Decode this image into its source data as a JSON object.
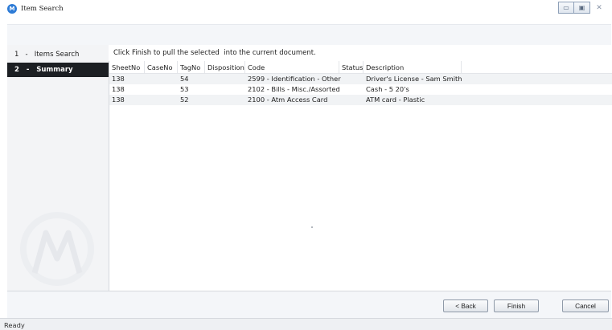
{
  "window": {
    "title": "Item Search",
    "app_icon": "motorola-icon",
    "controls": [
      "minimize-icon",
      "maximize-icon",
      "close-icon"
    ]
  },
  "sidebar": {
    "steps": [
      {
        "number": "1",
        "separator": "-",
        "label": "Items Search",
        "active": false
      },
      {
        "number": "2",
        "separator": "-",
        "label": "Summary",
        "active": true
      }
    ],
    "logo": "motorola-logo"
  },
  "main": {
    "instruction": "Click Finish to pull the selected  into the current document.",
    "table": {
      "columns": [
        "SheetNo",
        "CaseNo",
        "TagNo",
        "Disposition",
        "Code",
        "Status",
        "Description"
      ],
      "rows": [
        [
          "138",
          "",
          "54",
          "",
          "2599 - Identification - Other",
          "",
          "Driver's License - Sam Smith"
        ],
        [
          "138",
          "",
          "53",
          "",
          "2102 - Bills - Misc./Assorted",
          "",
          "Cash - 5 20's"
        ],
        [
          "138",
          "",
          "52",
          "",
          "2100 - Atm Access Card",
          "",
          "ATM card - Plastic"
        ]
      ]
    }
  },
  "buttons": {
    "back": "< Back",
    "finish": "Finish",
    "cancel": "Cancel"
  },
  "status": "Ready",
  "colors": {
    "active_step_bg": "#1c1f23",
    "accent": "#2d7bd6"
  }
}
